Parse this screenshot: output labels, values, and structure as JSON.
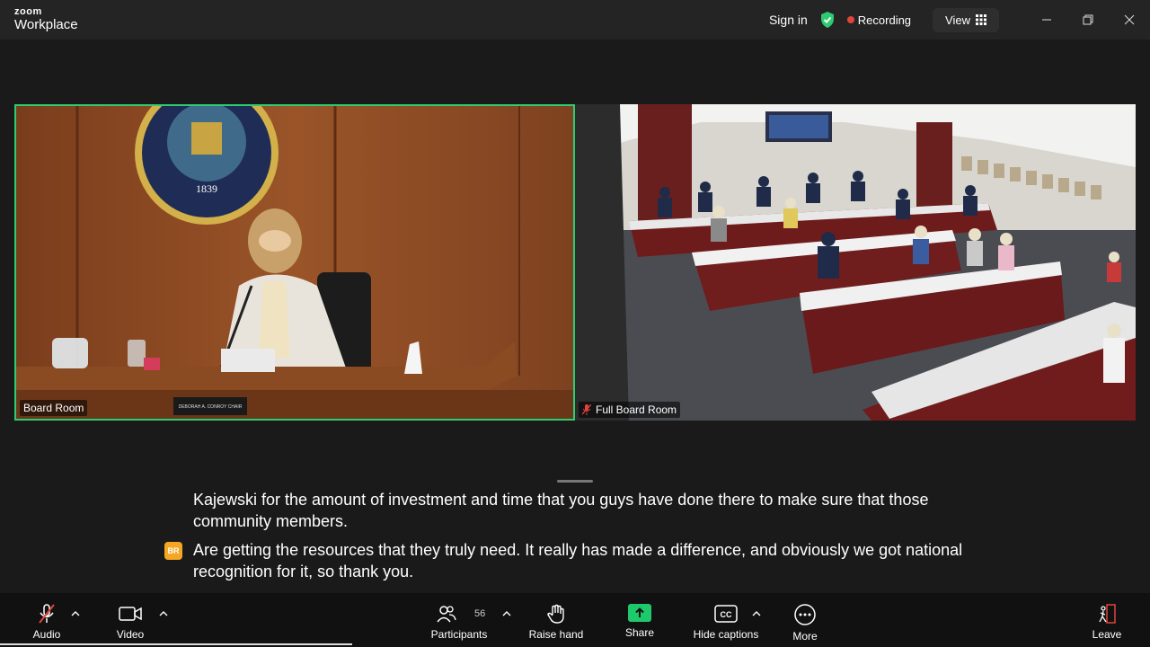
{
  "app": {
    "brand_top": "zoom",
    "brand_bottom": "Workplace"
  },
  "titlebar": {
    "signin": "Sign in",
    "recording": "Recording",
    "view": "View"
  },
  "tiles": [
    {
      "label": "Board Room",
      "seal_year": "1839",
      "nameplate": "DEBORAH A. CONROY CHAIR",
      "active_speaker": true
    },
    {
      "label": "Full Board Room",
      "muted": true
    }
  ],
  "captions": {
    "line1": "Kajewski for the amount of investment and time that you guys have done there to make sure that those community members.",
    "speaker_initials": "BR",
    "line2": "Are getting the resources that they truly need. It really has made a difference, and obviously we got national recognition for it, so thank you."
  },
  "toolbar": {
    "audio": "Audio",
    "video": "Video",
    "participants": "Participants",
    "participant_count": "56",
    "raise_hand": "Raise hand",
    "share": "Share",
    "hide_captions": "Hide captions",
    "more": "More",
    "leave": "Leave"
  },
  "colors": {
    "active_border": "#2ecc71",
    "recording_dot": "#e0453b",
    "share_green": "#1ec96b",
    "shield_green": "#2ecc71"
  }
}
